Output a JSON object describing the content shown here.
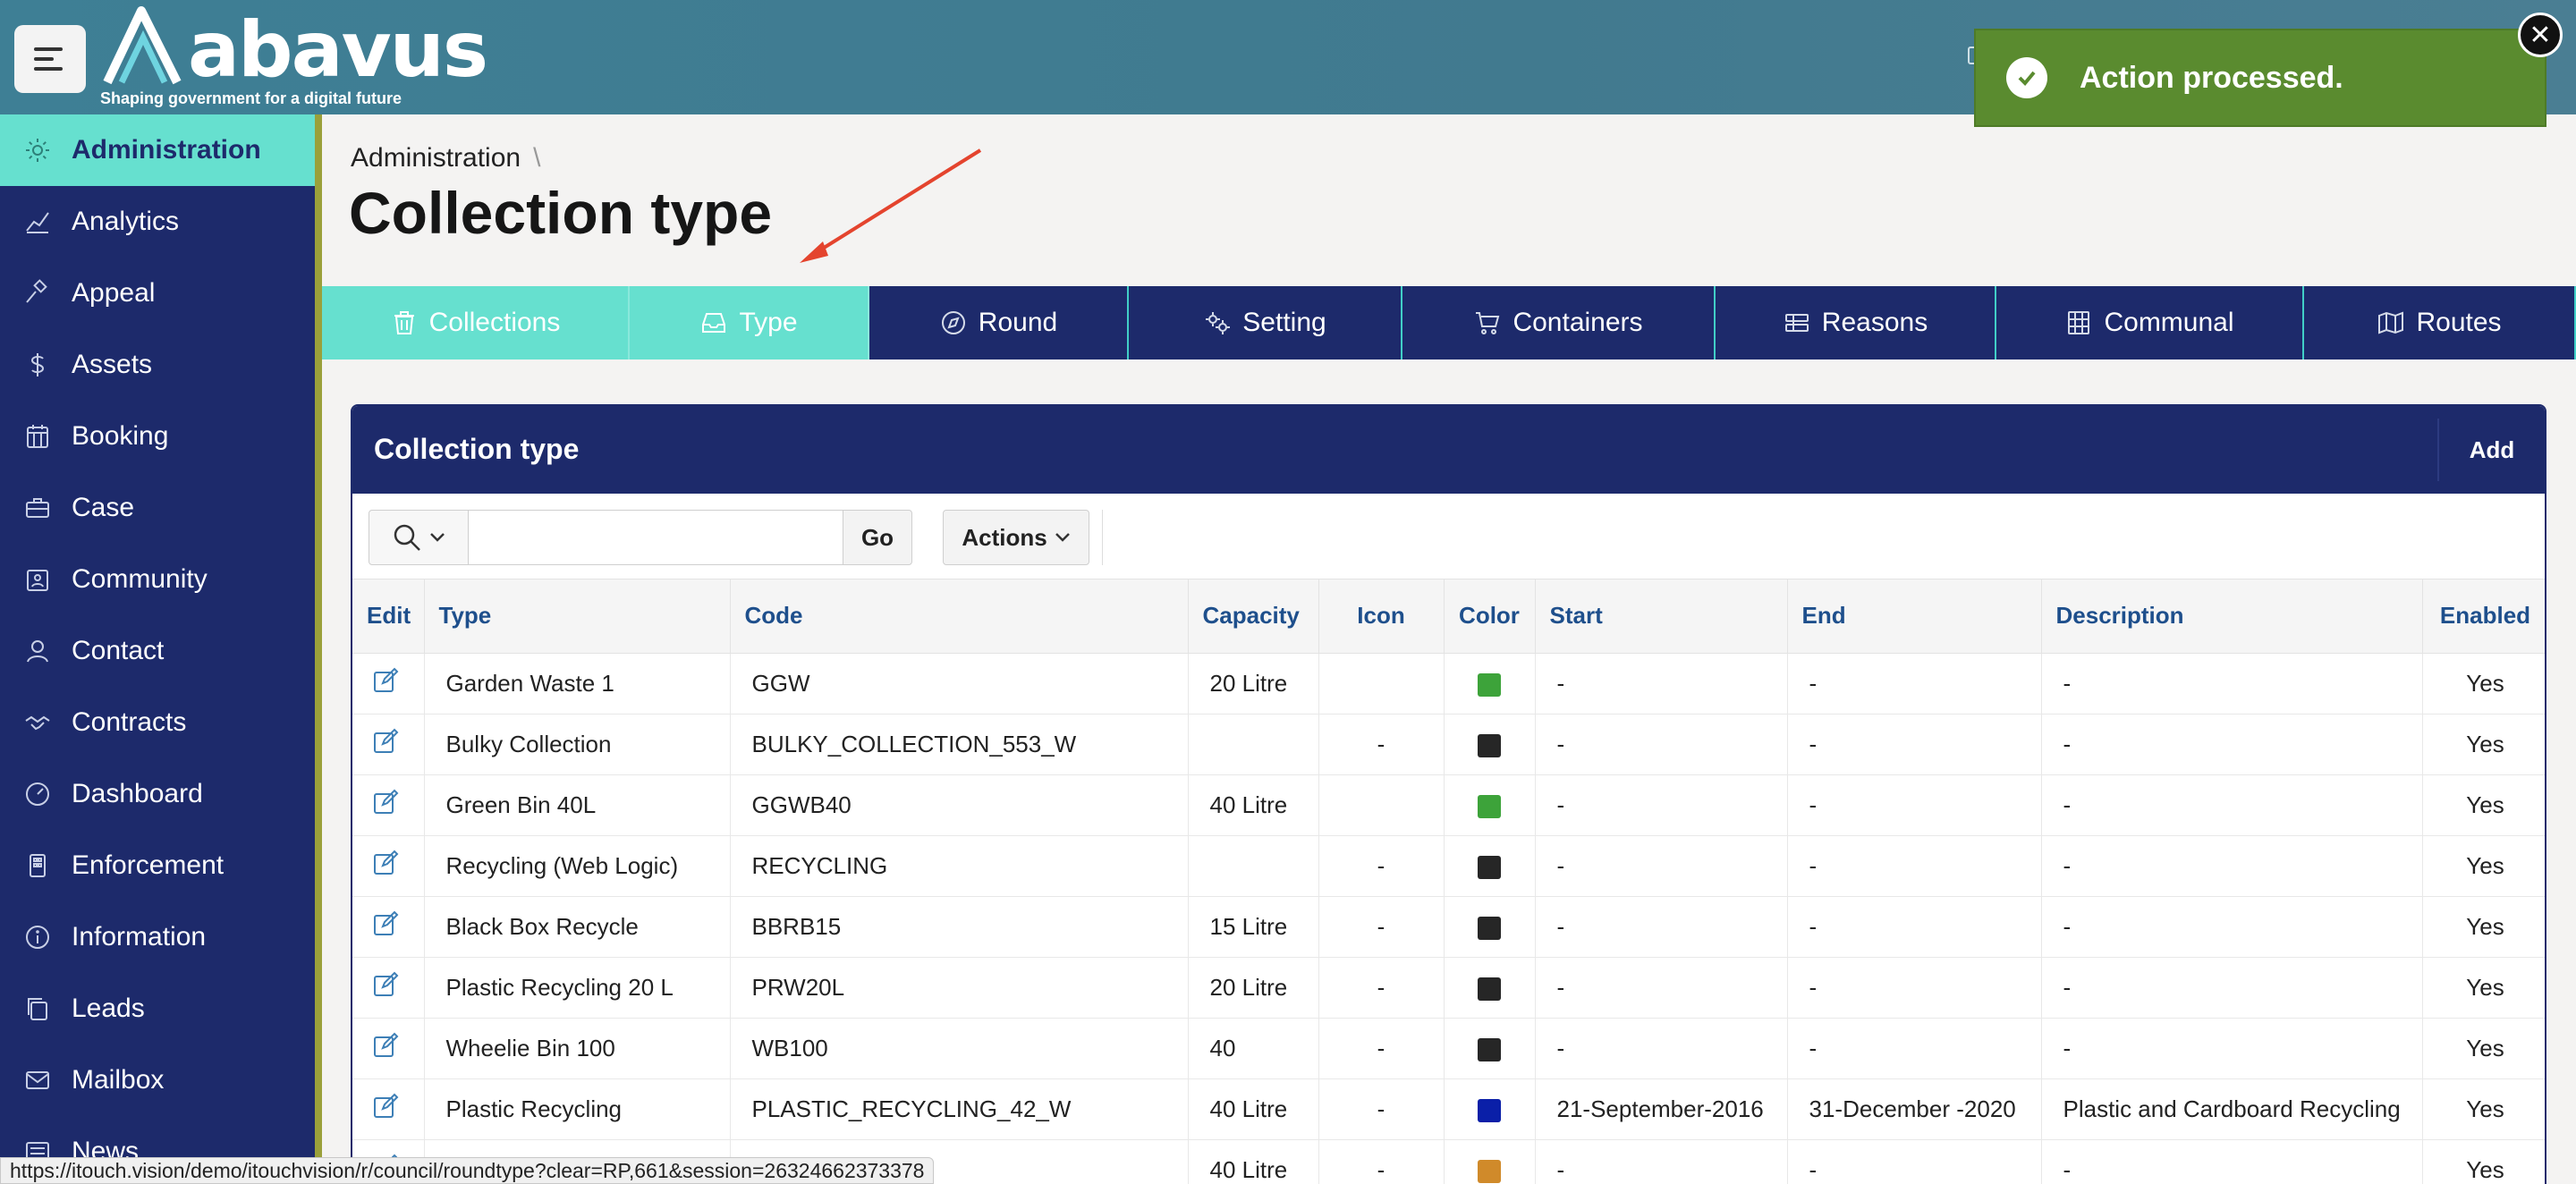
{
  "header": {
    "brand": "abavus",
    "tagline": "Shaping government for a digital future"
  },
  "toast": {
    "message": "Action processed.",
    "color": "#5a8b2f"
  },
  "sidebar": {
    "items": [
      {
        "label": "Administration",
        "icon": "gear-icon",
        "active": true
      },
      {
        "label": "Analytics",
        "icon": "chart-icon"
      },
      {
        "label": "Appeal",
        "icon": "gavel-icon"
      },
      {
        "label": "Assets",
        "icon": "dollar-icon"
      },
      {
        "label": "Booking",
        "icon": "calendar-icon"
      },
      {
        "label": "Case",
        "icon": "briefcase-icon"
      },
      {
        "label": "Community",
        "icon": "people-icon"
      },
      {
        "label": "Contact",
        "icon": "user-icon"
      },
      {
        "label": "Contracts",
        "icon": "handshake-icon"
      },
      {
        "label": "Dashboard",
        "icon": "gauge-icon"
      },
      {
        "label": "Enforcement",
        "icon": "building-icon"
      },
      {
        "label": "Information",
        "icon": "info-icon"
      },
      {
        "label": "Leads",
        "icon": "copy-icon"
      },
      {
        "label": "Mailbox",
        "icon": "mail-icon"
      },
      {
        "label": "News",
        "icon": "news-icon"
      }
    ]
  },
  "breadcrumb": {
    "parent": "Administration",
    "separator": "\\"
  },
  "page_title": "Collection type",
  "tabs": [
    {
      "label": "Collections",
      "icon": "trash-icon"
    },
    {
      "label": "Type",
      "icon": "tray-icon"
    },
    {
      "label": "Round",
      "icon": "compass-icon"
    },
    {
      "label": "Setting",
      "icon": "gears-icon"
    },
    {
      "label": "Containers",
      "icon": "cart-icon"
    },
    {
      "label": "Reasons",
      "icon": "list-icon"
    },
    {
      "label": "Communal",
      "icon": "grid-icon"
    },
    {
      "label": "Routes",
      "icon": "map-icon"
    }
  ],
  "region": {
    "title": "Collection type",
    "add_label": "Add",
    "go_label": "Go",
    "actions_label": "Actions",
    "search_value": ""
  },
  "table": {
    "columns": [
      "Edit",
      "Type",
      "Code",
      "Capacity",
      "Icon",
      "Color",
      "Start",
      "End",
      "Description",
      "Enabled"
    ],
    "rows": [
      {
        "type": "Garden Waste 1",
        "code": "GGW",
        "capacity": "20 Litre",
        "icon": "",
        "color": "#3da33a",
        "start": "-",
        "end": "-",
        "description": "-",
        "enabled": "Yes"
      },
      {
        "type": "Bulky Collection",
        "code": "BULKY_COLLECTION_553_W",
        "capacity": "",
        "icon": "-",
        "color": "#262626",
        "start": "-",
        "end": "-",
        "description": "-",
        "enabled": "Yes"
      },
      {
        "type": "Green Bin 40L",
        "code": "GGWB40",
        "capacity": "40 Litre",
        "icon": "",
        "color": "#3da33a",
        "start": "-",
        "end": "-",
        "description": "-",
        "enabled": "Yes"
      },
      {
        "type": "Recycling (Web Logic)",
        "code": "RECYCLING",
        "capacity": "",
        "icon": "-",
        "color": "#262626",
        "start": "-",
        "end": "-",
        "description": "-",
        "enabled": "Yes"
      },
      {
        "type": "Black Box Recycle",
        "code": "BBRB15",
        "capacity": "15 Litre",
        "icon": "-",
        "color": "#262626",
        "start": "-",
        "end": "-",
        "description": "-",
        "enabled": "Yes"
      },
      {
        "type": "Plastic Recycling 20 L",
        "code": "PRW20L",
        "capacity": "20 Litre",
        "icon": "-",
        "color": "#262626",
        "start": "-",
        "end": "-",
        "description": "-",
        "enabled": "Yes"
      },
      {
        "type": "Wheelie Bin 100",
        "code": "WB100",
        "capacity": "40",
        "icon": "-",
        "color": "#262626",
        "start": "-",
        "end": "-",
        "description": "-",
        "enabled": "Yes"
      },
      {
        "type": "Plastic Recycling",
        "code": "PLASTIC_RECYCLING_42_W",
        "capacity": "40 Litre",
        "icon": "-",
        "color": "#0a1fa8",
        "start": "21-September-2016",
        "end": "31-December -2020",
        "description": "Plastic and Cardboard Recycling",
        "enabled": "Yes"
      },
      {
        "type": "",
        "code": "",
        "capacity": "40 Litre",
        "icon": "-",
        "color": "#d08a2a",
        "start": "-",
        "end": "-",
        "description": "-",
        "enabled": "Yes"
      }
    ]
  },
  "status_url": "https://itouch.vision/demo/itouchvision/r/council/roundtype?clear=RP,661&session=26324662373378"
}
